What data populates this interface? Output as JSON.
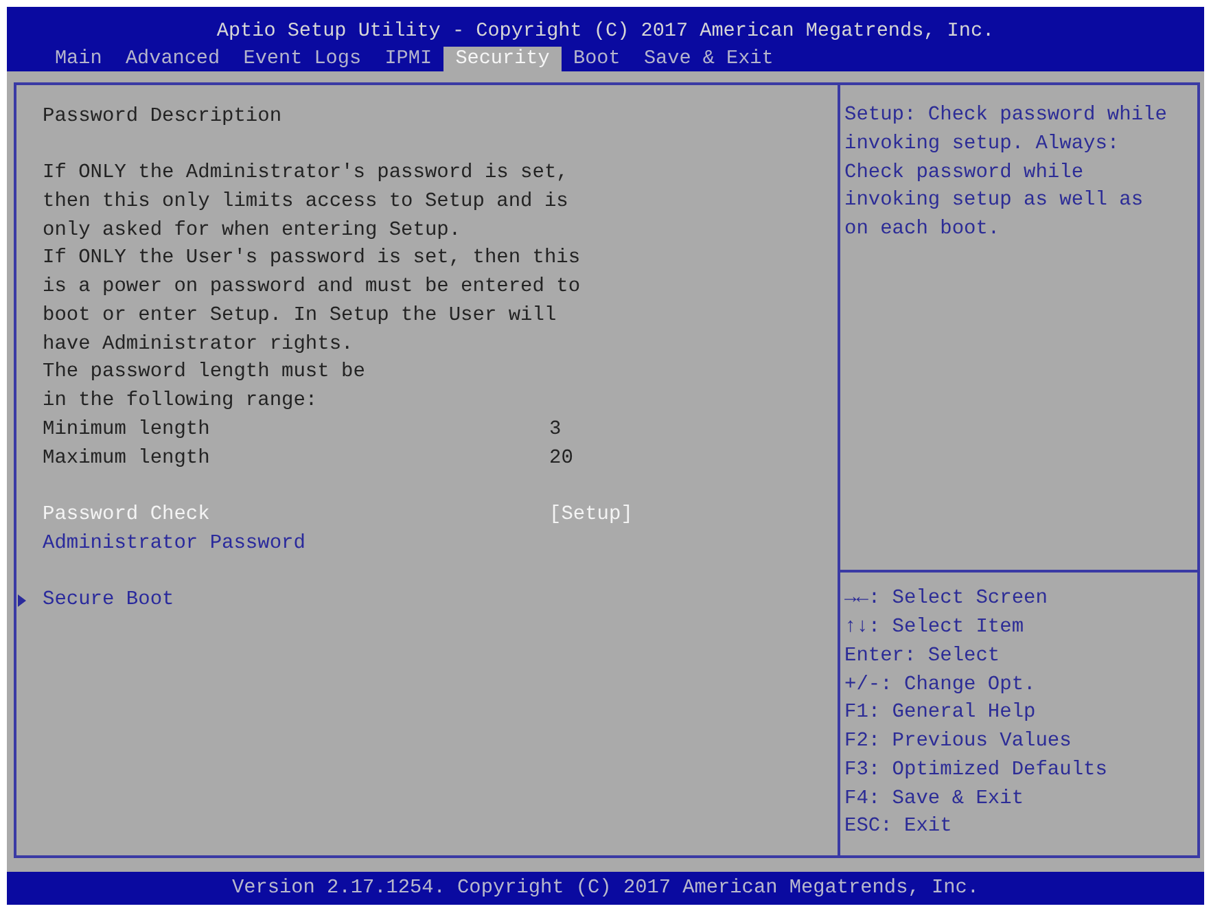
{
  "window": {
    "title": "Aptio Setup Utility - Copyright (C) 2017 American Megatrends, Inc."
  },
  "tabs": [
    {
      "label": "Main",
      "selected": false
    },
    {
      "label": "Advanced",
      "selected": false
    },
    {
      "label": "Event Logs",
      "selected": false
    },
    {
      "label": "IPMI",
      "selected": false
    },
    {
      "label": "Security",
      "selected": true
    },
    {
      "label": "Boot",
      "selected": false
    },
    {
      "label": "Save & Exit",
      "selected": false
    }
  ],
  "settings_panel": {
    "heading": "Password Description",
    "paragraphs": [
      "If ONLY the Administrator's password is set,\nthen this only limits access to Setup and is\nonly asked for when entering Setup.",
      "If ONLY the User's password is set, then this\nis a power on password and must be entered to\nboot or enter Setup. In Setup the User will\nhave Administrator rights.",
      "The password length must be\nin the following range:"
    ],
    "info_rows": [
      {
        "label": "Minimum length",
        "value": "3"
      },
      {
        "label": "Maximum length",
        "value": "20"
      }
    ],
    "item_groups": [
      [
        {
          "kind": "option",
          "label": "Password Check",
          "value": "[Setup]",
          "selected": true
        },
        {
          "kind": "action",
          "label": "Administrator Password",
          "selected": false
        }
      ],
      [
        {
          "kind": "submenu",
          "label": "Secure Boot",
          "selected": false
        }
      ]
    ]
  },
  "help_panel": {
    "description": "Setup: Check password while\ninvoking setup. Always:\nCheck password while\ninvoking setup as well as\non each boot.",
    "keys": [
      "→←: Select Screen",
      "↑↓: Select Item",
      "Enter: Select",
      "+/-: Change Opt.",
      "F1: General Help",
      "F2: Previous Values",
      "F3: Optimized Defaults",
      "F4: Save & Exit",
      "ESC: Exit"
    ]
  },
  "status_bar": "Version 2.17.1254. Copyright (C) 2017 American Megatrends, Inc."
}
